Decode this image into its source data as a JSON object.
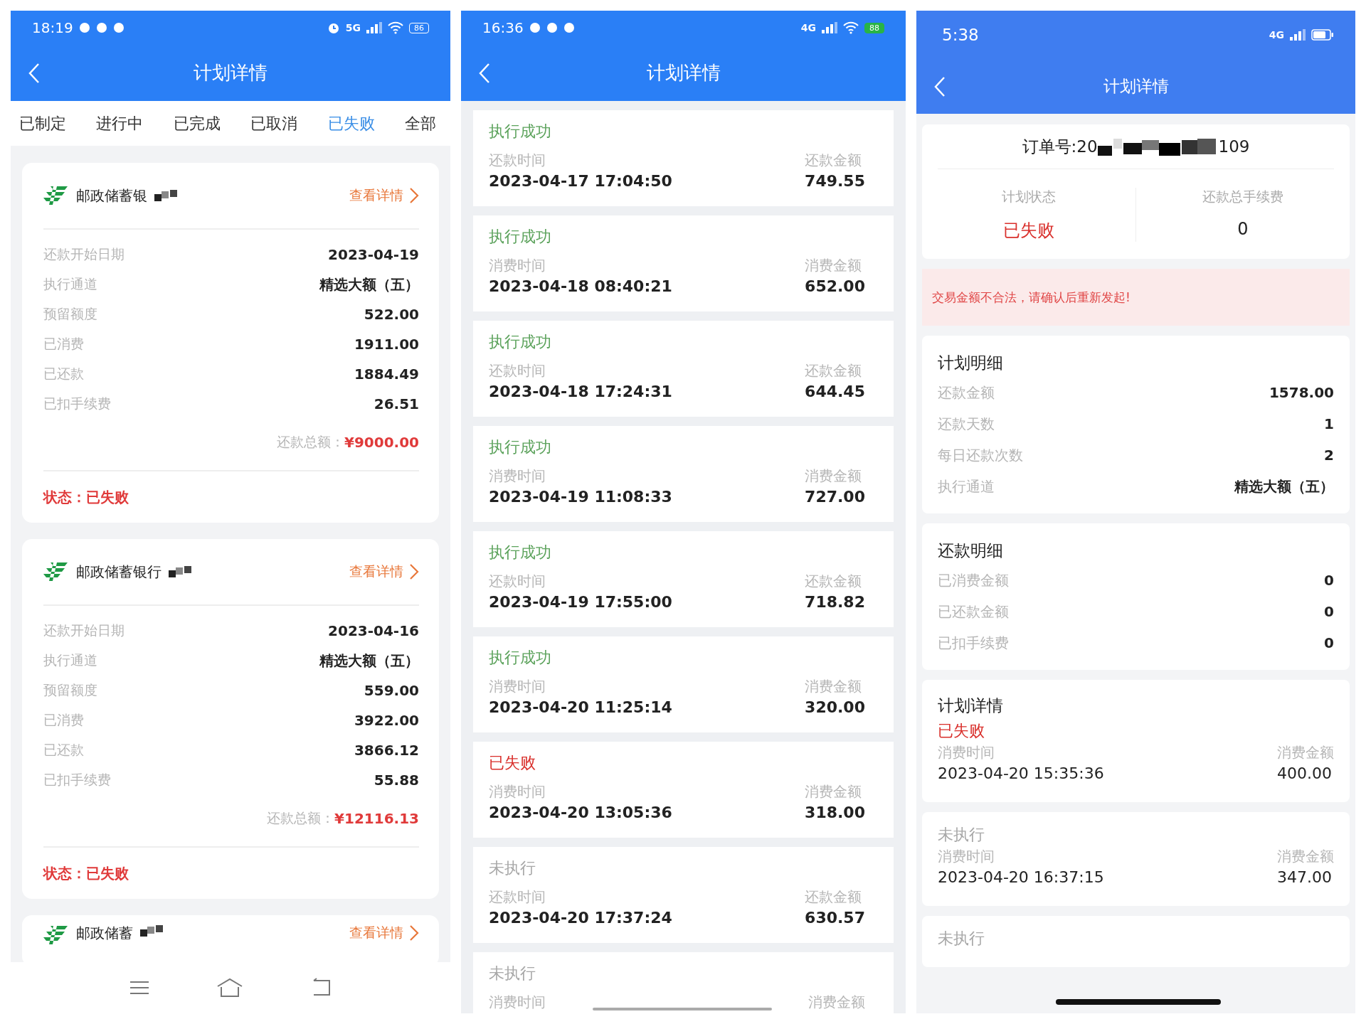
{
  "screens": [
    {
      "kind": "plan_list",
      "status_bar": {
        "time": "18:19",
        "network": "5G",
        "battery": "86"
      },
      "title": "计划详情",
      "tabs": [
        {
          "label": "已制定",
          "selected": false
        },
        {
          "label": "进行中",
          "selected": false
        },
        {
          "label": "已完成",
          "selected": false
        },
        {
          "label": "已取消",
          "selected": false
        },
        {
          "label": "已失败",
          "selected": true
        },
        {
          "label": "全部",
          "selected": false
        }
      ],
      "plans": [
        {
          "bank": "邮政储蓄银",
          "link": "查看详情",
          "fields": [
            {
              "label": "还款开始日期",
              "value": "2023-04-19"
            },
            {
              "label": "执行通道",
              "value": "精选大额（五）"
            },
            {
              "label": "预留额度",
              "value": "522.00"
            },
            {
              "label": "已消费",
              "value": "1911.00"
            },
            {
              "label": "已还款",
              "value": "1884.49"
            },
            {
              "label": "已扣手续费",
              "value": "26.51"
            }
          ],
          "total_label": "还款总额：",
          "total": "¥9000.00",
          "status": "状态：已失败"
        },
        {
          "bank": "邮政储蓄银行",
          "link": "查看详情",
          "fields": [
            {
              "label": "还款开始日期",
              "value": "2023-04-16"
            },
            {
              "label": "执行通道",
              "value": "精选大额（五）"
            },
            {
              "label": "预留额度",
              "value": "559.00"
            },
            {
              "label": "已消费",
              "value": "3922.00"
            },
            {
              "label": "已还款",
              "value": "3866.12"
            },
            {
              "label": "已扣手续费",
              "value": "55.88"
            }
          ],
          "total_label": "还款总额：",
          "total": "¥12116.13",
          "status": "状态：已失败"
        },
        {
          "bank": "邮政储蓄",
          "link": "查看详情"
        }
      ]
    },
    {
      "kind": "record_list",
      "status_bar": {
        "time": "16:36",
        "network": "4G",
        "battery": "88"
      },
      "title": "计划详情",
      "records": [
        {
          "kind": "success",
          "status": "执行成功",
          "time_label": "还款时间",
          "time": "2023-04-17 17:04:50",
          "amount_label": "还款金额",
          "amount": "749.55"
        },
        {
          "kind": "success",
          "status": "执行成功",
          "time_label": "消费时间",
          "time": "2023-04-18 08:40:21",
          "amount_label": "消费金额",
          "amount": "652.00"
        },
        {
          "kind": "success",
          "status": "执行成功",
          "time_label": "还款时间",
          "time": "2023-04-18 17:24:31",
          "amount_label": "还款金额",
          "amount": "644.45"
        },
        {
          "kind": "success",
          "status": "执行成功",
          "time_label": "消费时间",
          "time": "2023-04-19 11:08:33",
          "amount_label": "消费金额",
          "amount": "727.00"
        },
        {
          "kind": "success",
          "status": "执行成功",
          "time_label": "还款时间",
          "time": "2023-04-19 17:55:00",
          "amount_label": "还款金额",
          "amount": "718.82"
        },
        {
          "kind": "success",
          "status": "执行成功",
          "time_label": "消费时间",
          "time": "2023-04-20 11:25:14",
          "amount_label": "消费金额",
          "amount": "320.00"
        },
        {
          "kind": "failed",
          "status": "已失败",
          "time_label": "消费时间",
          "time": "2023-04-20 13:05:36",
          "amount_label": "消费金额",
          "amount": "318.00"
        },
        {
          "kind": "pending",
          "status": "未执行",
          "time_label": "还款时间",
          "time": "2023-04-20 17:37:24",
          "amount_label": "还款金额",
          "amount": "630.57"
        },
        {
          "kind": "pending",
          "status": "未执行",
          "time_label": "消费时间",
          "amount_label": "消费金额"
        }
      ]
    },
    {
      "kind": "plan_detail",
      "status_bar": {
        "time": "5:38",
        "network": "4G"
      },
      "title": "计划详情",
      "order": {
        "prefix": "订单号:20",
        "suffix": "109"
      },
      "summary": [
        {
          "label": "计划状态",
          "value": "已失败",
          "kind": "failed"
        },
        {
          "label": "还款总手续费",
          "value": "0",
          "kind": "normal"
        }
      ],
      "alert": "交易金额不合法，请确认后重新发起!",
      "sections": [
        {
          "title": "计划明细",
          "rows": [
            {
              "label": "还款金额",
              "value": "1578.00"
            },
            {
              "label": "还款天数",
              "value": "1"
            },
            {
              "label": "每日还款次数",
              "value": "2"
            },
            {
              "label": "执行通道",
              "value": "精选大额（五）"
            }
          ]
        },
        {
          "title": "还款明细",
          "rows": [
            {
              "label": "已消费金额",
              "value": "0"
            },
            {
              "label": "已还款金额",
              "value": "0"
            },
            {
              "label": "已扣手续费",
              "value": "0"
            }
          ]
        }
      ],
      "records_title": "计划详情",
      "records": [
        {
          "kind": "failed",
          "status": "已失败",
          "time_label": "消费时间",
          "time": "2023-04-20 15:35:36",
          "amount_label": "消费金额",
          "amount": "400.00"
        },
        {
          "kind": "pending",
          "status": "未执行",
          "time_label": "消费时间",
          "time": "2023-04-20 16:37:15",
          "amount_label": "消费金额",
          "amount": "347.00"
        },
        {
          "kind": "pending",
          "status": "未执行"
        }
      ]
    }
  ]
}
